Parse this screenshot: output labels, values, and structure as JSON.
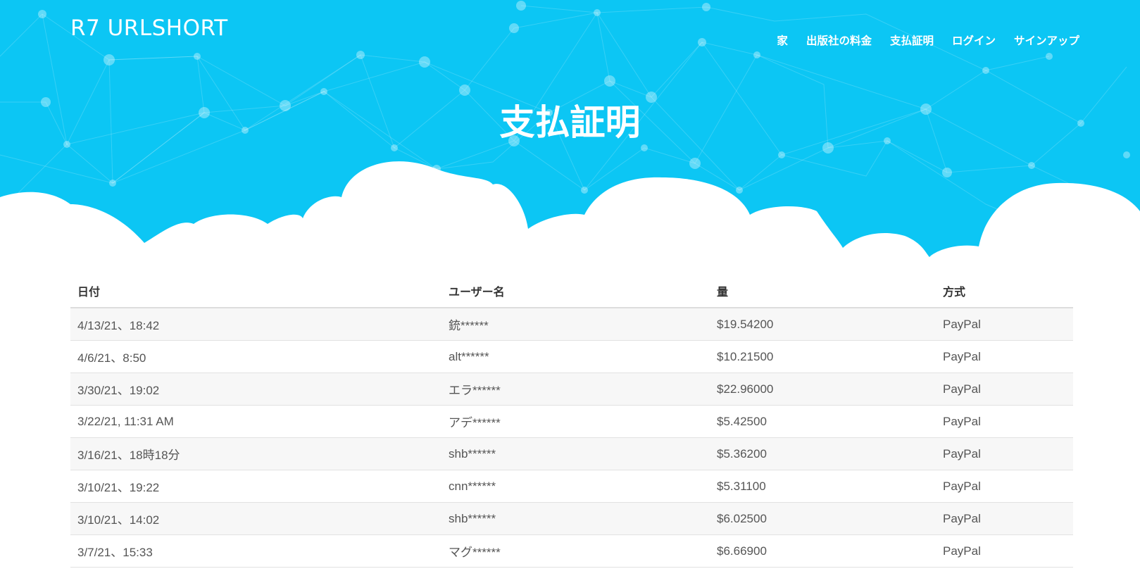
{
  "brand": "R7 URLSHORT",
  "nav": [
    {
      "label": "家"
    },
    {
      "label": "出版社の料金"
    },
    {
      "label": "支払証明"
    },
    {
      "label": "ログイン"
    },
    {
      "label": "サインアップ"
    }
  ],
  "page_title": "支払証明",
  "table": {
    "headers": {
      "date": "日付",
      "username": "ユーザー名",
      "amount": "量",
      "method": "方式"
    },
    "rows": [
      {
        "date": "4/13/21、18:42",
        "username": "銃******",
        "amount": "$19.54200",
        "method": "PayPal"
      },
      {
        "date": "4/6/21、8:50",
        "username": "alt******",
        "amount": "$10.21500",
        "method": "PayPal"
      },
      {
        "date": "3/30/21、19:02",
        "username": "エラ******",
        "amount": "$22.96000",
        "method": "PayPal"
      },
      {
        "date": "3/22/21, 11:31 AM",
        "username": "アデ******",
        "amount": "$5.42500",
        "method": "PayPal"
      },
      {
        "date": "3/16/21、18時18分",
        "username": "shb******",
        "amount": "$5.36200",
        "method": "PayPal"
      },
      {
        "date": "3/10/21、19:22",
        "username": "cnn******",
        "amount": "$5.31100",
        "method": "PayPal"
      },
      {
        "date": "3/10/21、14:02",
        "username": "shb******",
        "amount": "$6.02500",
        "method": "PayPal"
      },
      {
        "date": "3/7/21、15:33",
        "username": "マグ******",
        "amount": "$6.66900",
        "method": "PayPal"
      }
    ]
  },
  "colors": {
    "hero_bg": "#0cc6f4",
    "nav_text": "#ffffff",
    "table_stripe": "#f7f7f7"
  }
}
